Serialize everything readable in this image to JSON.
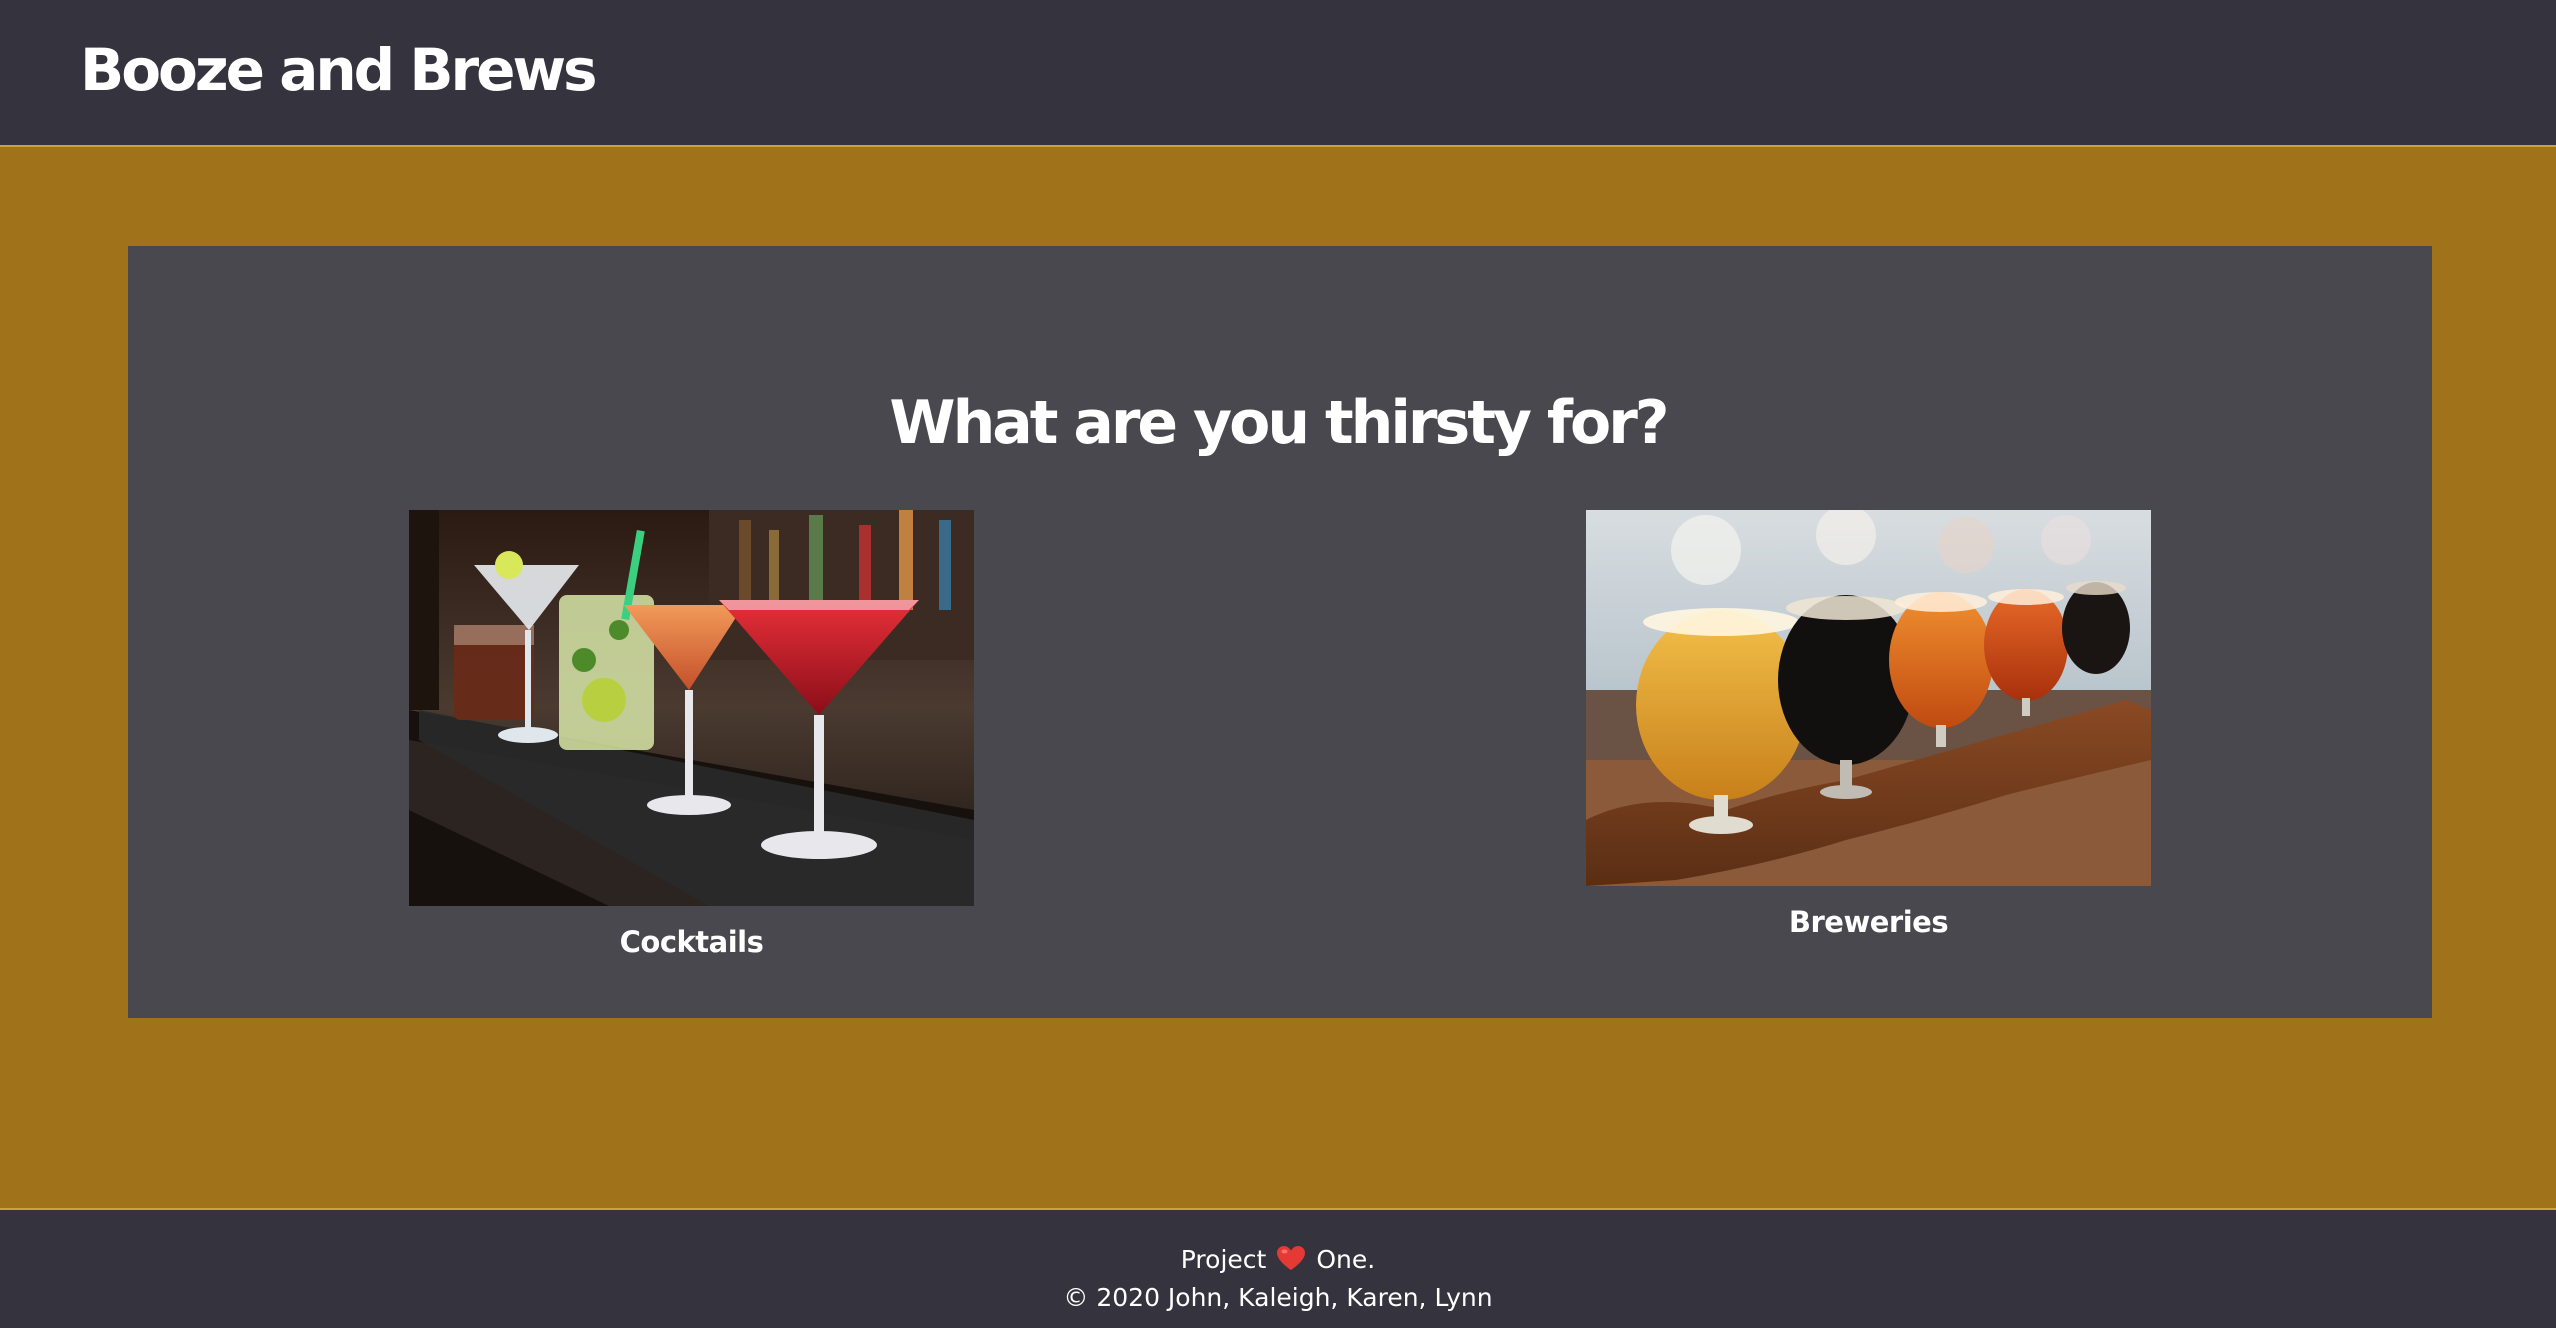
{
  "header": {
    "title": "Booze and Brews"
  },
  "main": {
    "heading": "What are you thirsty for?",
    "options": [
      {
        "label": "Cocktails",
        "image_icon": "cocktail-glasses-photo"
      },
      {
        "label": "Breweries",
        "image_icon": "beer-flight-photo"
      }
    ]
  },
  "footer": {
    "project_prefix": "Project",
    "project_suffix": "One.",
    "heart_icon": "heart-icon",
    "heart_color": "#E53935",
    "copyright": "© 2020 John, Kaleigh, Karen, Lynn"
  },
  "colors": {
    "page_background": "#A07219",
    "header_background": "#35333D",
    "card_background": "#4A484F",
    "accent_border": "#C9A23C",
    "text": "#FFFFFF"
  }
}
